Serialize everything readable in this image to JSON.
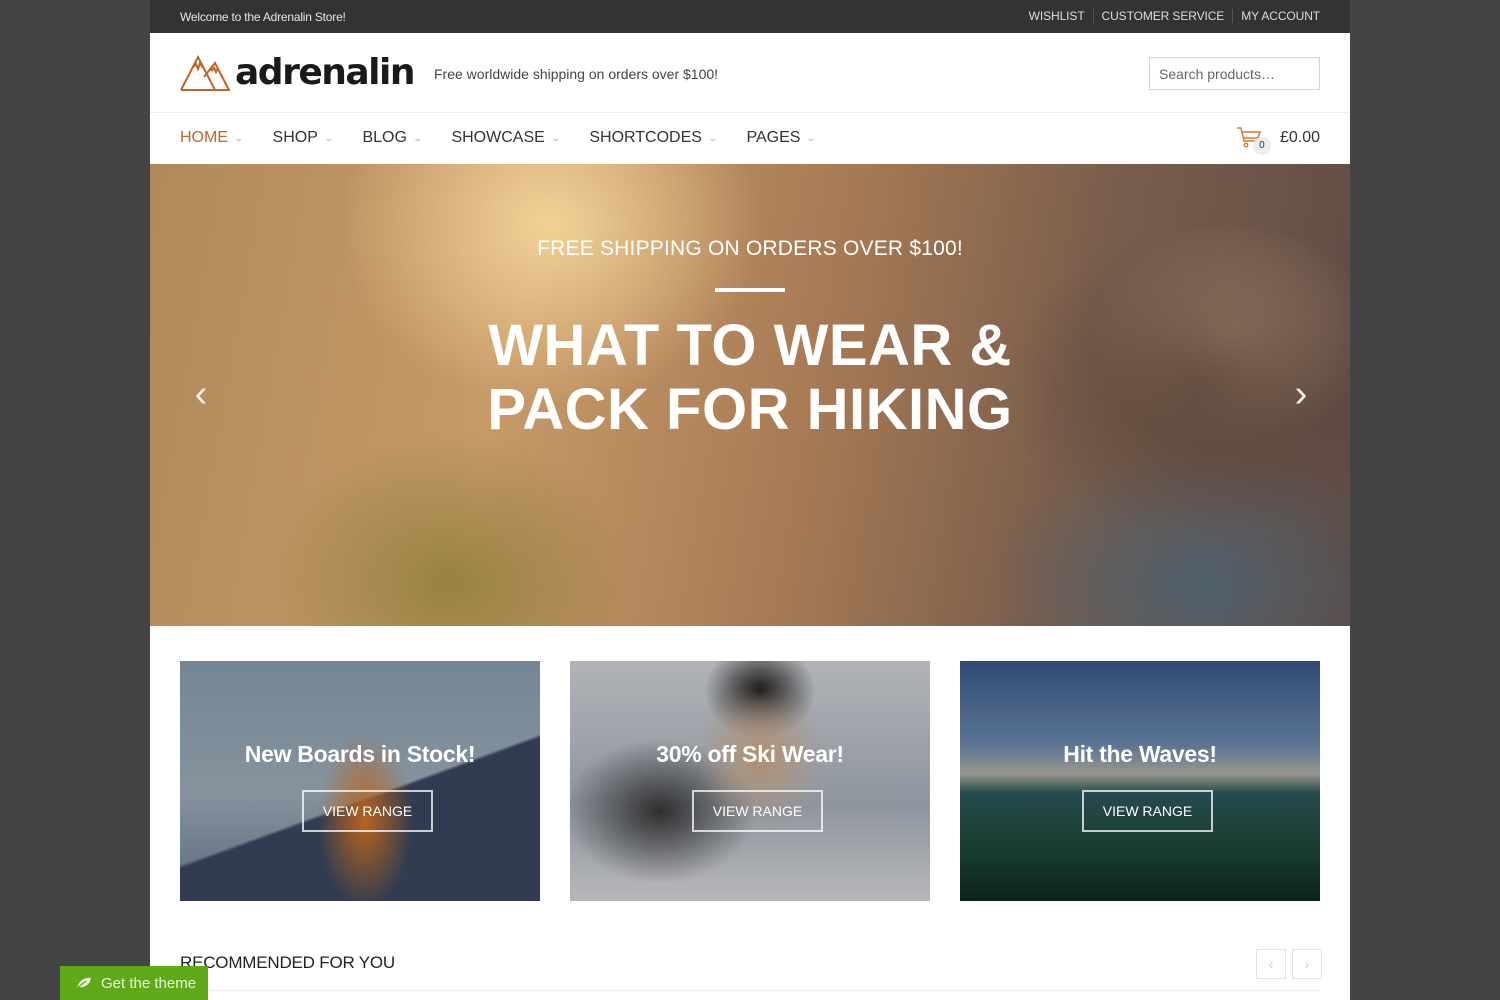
{
  "topbar": {
    "welcome": "Welcome to the Adrenalin Store!",
    "links": [
      "WISHLIST",
      "CUSTOMER SERVICE",
      "MY ACCOUNT"
    ]
  },
  "header": {
    "logo_text": "adrenalin",
    "tagline": "Free worldwide shipping on orders over $100!",
    "search_placeholder": "Search products…"
  },
  "nav": {
    "items": [
      {
        "label": "HOME",
        "active": true
      },
      {
        "label": "SHOP",
        "active": false
      },
      {
        "label": "BLOG",
        "active": false
      },
      {
        "label": "SHOWCASE",
        "active": false
      },
      {
        "label": "SHORTCODES",
        "active": false
      },
      {
        "label": "PAGES",
        "active": false
      }
    ],
    "cart_count": "0",
    "cart_total": "£0.00"
  },
  "hero": {
    "subtitle": "FREE SHIPPING ON ORDERS OVER $100!",
    "title_line1": "WHAT TO WEAR &",
    "title_line2": "PACK FOR HIKING",
    "prev_icon": "‹",
    "next_icon": "›"
  },
  "promos": [
    {
      "title": "New Boards in Stock!",
      "button": "VIEW RANGE"
    },
    {
      "title": "30% off Ski Wear!",
      "button": "VIEW RANGE"
    },
    {
      "title": "Hit the Waves!",
      "button": "VIEW RANGE"
    }
  ],
  "recommended": {
    "title": "RECOMMENDED FOR YOU",
    "prev_icon": "‹",
    "next_icon": "›"
  },
  "get_theme": {
    "label": "Get the theme"
  },
  "colors": {
    "accent": "#c0642a",
    "topbar_bg": "#333333",
    "get_theme_bg": "#5fa91a"
  }
}
